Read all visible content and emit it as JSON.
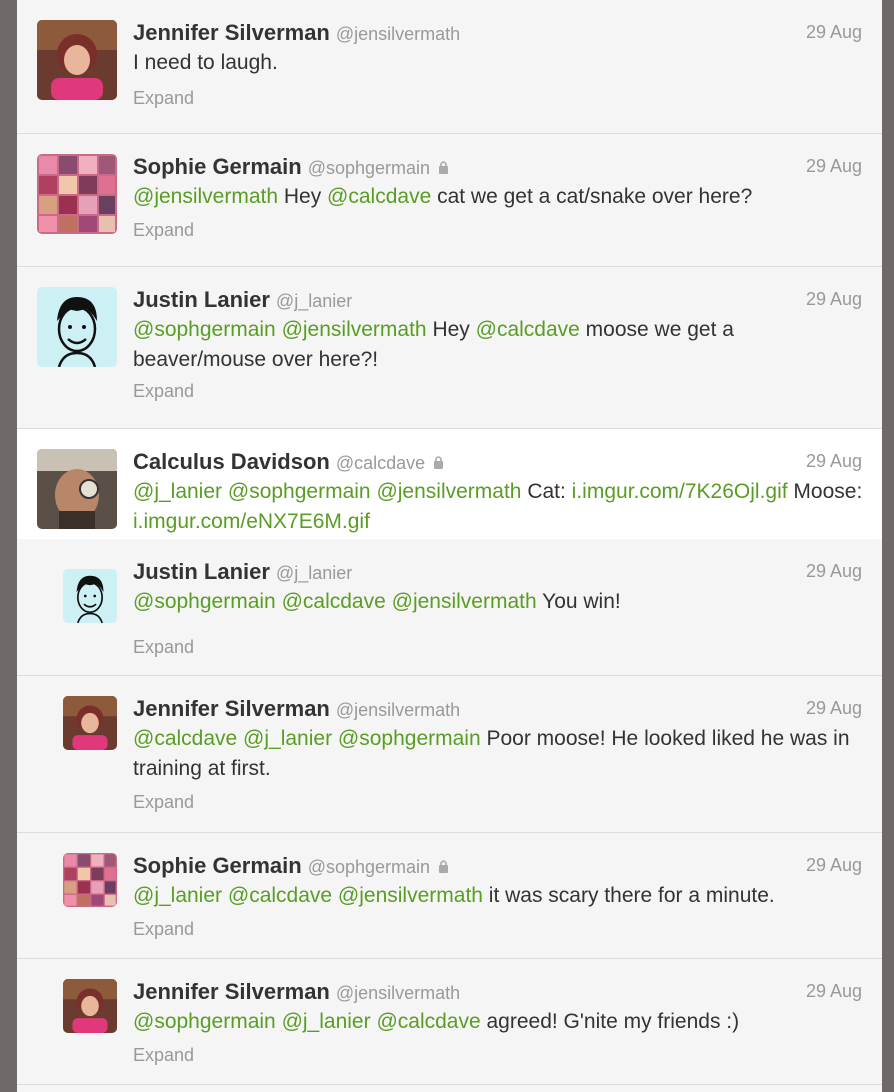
{
  "colors": {
    "mention": "#5a9d24",
    "name": "#333333",
    "meta": "#999999",
    "background": "#6f6967"
  },
  "tweets": [
    {
      "name": "Jennifer Silverman",
      "handle": "@jensilvermath",
      "protected": false,
      "date": "29 Aug",
      "segments": [
        {
          "t": "I need to laugh.",
          "k": "text"
        }
      ],
      "expand": "Expand",
      "avatar": "photo-woman-icon"
    },
    {
      "name": "Sophie Germain",
      "handle": "@sophgermain",
      "protected": true,
      "date": "29 Aug",
      "segments": [
        {
          "t": "@jensilvermath",
          "k": "mention"
        },
        {
          "t": " Hey ",
          "k": "text"
        },
        {
          "t": "@calcdave",
          "k": "mention"
        },
        {
          "t": " cat we get a cat/snake over here?",
          "k": "text"
        }
      ],
      "expand": "Expand",
      "avatar": "photo-collage-icon"
    },
    {
      "name": "Justin Lanier",
      "handle": "@j_lanier",
      "protected": false,
      "date": "29 Aug",
      "segments": [
        {
          "t": "@sophgermain",
          "k": "mention"
        },
        {
          "t": " ",
          "k": "text"
        },
        {
          "t": "@jensilvermath",
          "k": "mention"
        },
        {
          "t": " Hey ",
          "k": "text"
        },
        {
          "t": "@calcdave",
          "k": "mention"
        },
        {
          "t": " moose we get a beaver/mouse over here?!",
          "k": "text"
        }
      ],
      "expand": "Expand",
      "avatar": "sketch-face-icon"
    },
    {
      "name": "Calculus Davidson",
      "handle": "@calcdave",
      "protected": true,
      "date": "29 Aug",
      "segments": [
        {
          "t": "@j_lanier",
          "k": "mention"
        },
        {
          "t": " ",
          "k": "text"
        },
        {
          "t": "@sophgermain",
          "k": "mention"
        },
        {
          "t": " ",
          "k": "text"
        },
        {
          "t": "@jensilvermath",
          "k": "mention"
        },
        {
          "t": " Cat: ",
          "k": "text"
        },
        {
          "t": "i.imgur.com/7K26Ojl.gif",
          "k": "link"
        },
        {
          "t": " Moose: ",
          "k": "text"
        },
        {
          "t": "i.imgur.com/eNX7E6M.gif",
          "k": "link"
        }
      ],
      "expand": "",
      "avatar": "photo-man-icon"
    },
    {
      "name": "Justin Lanier",
      "handle": "@j_lanier",
      "protected": false,
      "date": "29 Aug",
      "segments": [
        {
          "t": "@sophgermain",
          "k": "mention"
        },
        {
          "t": " ",
          "k": "text"
        },
        {
          "t": "@calcdave",
          "k": "mention"
        },
        {
          "t": " ",
          "k": "text"
        },
        {
          "t": "@jensilvermath",
          "k": "mention"
        },
        {
          "t": " You win!",
          "k": "text"
        }
      ],
      "expand": "Expand",
      "avatar": "sketch-face-icon"
    },
    {
      "name": "Jennifer Silverman",
      "handle": "@jensilvermath",
      "protected": false,
      "date": "29 Aug",
      "segments": [
        {
          "t": "@calcdave",
          "k": "mention"
        },
        {
          "t": " ",
          "k": "text"
        },
        {
          "t": "@j_lanier",
          "k": "mention"
        },
        {
          "t": " ",
          "k": "text"
        },
        {
          "t": "@sophgermain",
          "k": "mention"
        },
        {
          "t": " Poor moose! He looked liked he was in training at first.",
          "k": "text"
        }
      ],
      "expand": "Expand",
      "avatar": "photo-woman-icon"
    },
    {
      "name": "Sophie Germain",
      "handle": "@sophgermain",
      "protected": true,
      "date": "29 Aug",
      "segments": [
        {
          "t": "@j_lanier",
          "k": "mention"
        },
        {
          "t": " ",
          "k": "text"
        },
        {
          "t": "@calcdave",
          "k": "mention"
        },
        {
          "t": " ",
          "k": "text"
        },
        {
          "t": "@jensilvermath",
          "k": "mention"
        },
        {
          "t": " it was scary there for a minute.",
          "k": "text"
        }
      ],
      "expand": "Expand",
      "avatar": "photo-collage-icon"
    },
    {
      "name": "Jennifer Silverman",
      "handle": "@jensilvermath",
      "protected": false,
      "date": "29 Aug",
      "segments": [
        {
          "t": "@sophgermain",
          "k": "mention"
        },
        {
          "t": " ",
          "k": "text"
        },
        {
          "t": "@j_lanier",
          "k": "mention"
        },
        {
          "t": " ",
          "k": "text"
        },
        {
          "t": "@calcdave",
          "k": "mention"
        },
        {
          "t": " agreed! G'nite my friends :)",
          "k": "text"
        }
      ],
      "expand": "Expand",
      "avatar": "photo-woman-icon"
    }
  ]
}
